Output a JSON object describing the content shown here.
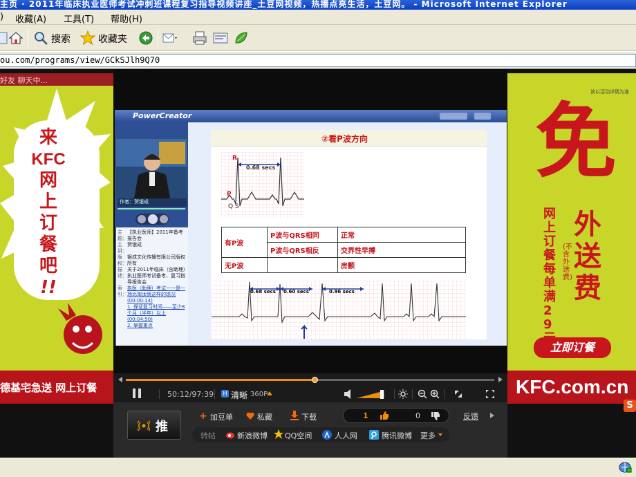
{
  "window": {
    "title": "主页 · 2011年临床执业医师考试冲刺班课程复习指导视频讲座_土豆网视频，热播点亮生活，土豆网。 - Microsoft Internet Explorer"
  },
  "menu": {
    "items": [
      "收藏(A)",
      "工具(T)",
      "帮助(H)"
    ],
    "lead": ")"
  },
  "toolbar": {
    "search_label": "搜索",
    "favorites_label": "收藏夹"
  },
  "address": {
    "url": "ou.com/programs/view/GCkSJlh9Q70"
  },
  "left_ad": {
    "top_text": "好友 聊天中...",
    "big_text": [
      "来",
      "KFC",
      "网",
      "上",
      "订",
      "餐",
      "吧",
      "!!"
    ],
    "bottom_text": "德基宅急送 网上订餐"
  },
  "right_ad": {
    "top_small": "该以活动详情为准",
    "big_char": "免",
    "side_text": "外送费",
    "vertical_left": "网上订餐每单满29元",
    "note": "(不含外送费)",
    "cta": "立即订餐",
    "domain": "KFC.com.cn"
  },
  "video": {
    "player_logo": "PowerCreator",
    "speaker_caption": "作者：贺银成",
    "info": [
      {
        "k": "主题：",
        "v": "【执业医师】2011年备考报告会"
      },
      {
        "k": "主讲：",
        "v": "贺银成"
      },
      {
        "k": "版权：",
        "v": "银成文化传播有限公司版权所有"
      },
      {
        "k": "描述：",
        "v": "关于2011年临床（含助理）执业医师考试备考、复习指导报告会"
      },
      {
        "k": "索引：",
        "v": "执医（助理）考试一一是一场比淘汰就这样的现况 (00:00:14)"
      }
    ],
    "index_items": [
      "1. 保证复习时间——至少8个月（半年）以上 (00:04:50)",
      "2. 掌握重点"
    ],
    "slide_title": "②看P波方向",
    "ecg_labels": {
      "R": "R",
      "P": "P",
      "QS": "Q S",
      "interval1": "0.68 secs"
    },
    "table": [
      [
        "有P波",
        "P波与QRS相同",
        "正常"
      ],
      [
        "",
        "P波与QRS相反",
        "交界性早搏"
      ],
      [
        "无P波",
        "",
        "房颤"
      ]
    ],
    "strip_labels": [
      "0.68 secs",
      "0.60 secs",
      "0.96 secs"
    ]
  },
  "player": {
    "time": "50:12/97:39",
    "quality_label": "清晰",
    "quality_value": "360P",
    "progress": 0.514
  },
  "actions": {
    "push_label": "推",
    "add_douban": "加豆单",
    "favorite": "私藏",
    "download": "下载",
    "up_count": "1",
    "down_count": "0",
    "feedback": "反馈"
  },
  "share": {
    "label": "转帖",
    "items": [
      "新浪微博",
      "QQ空间",
      "人人网",
      "腾讯微博"
    ],
    "more": "更多"
  },
  "colors": {
    "brand_red": "#c8171c",
    "ad_green": "#c8d62a",
    "player_orange": "#f08c10",
    "ie_blue": "#0a3fc2"
  }
}
